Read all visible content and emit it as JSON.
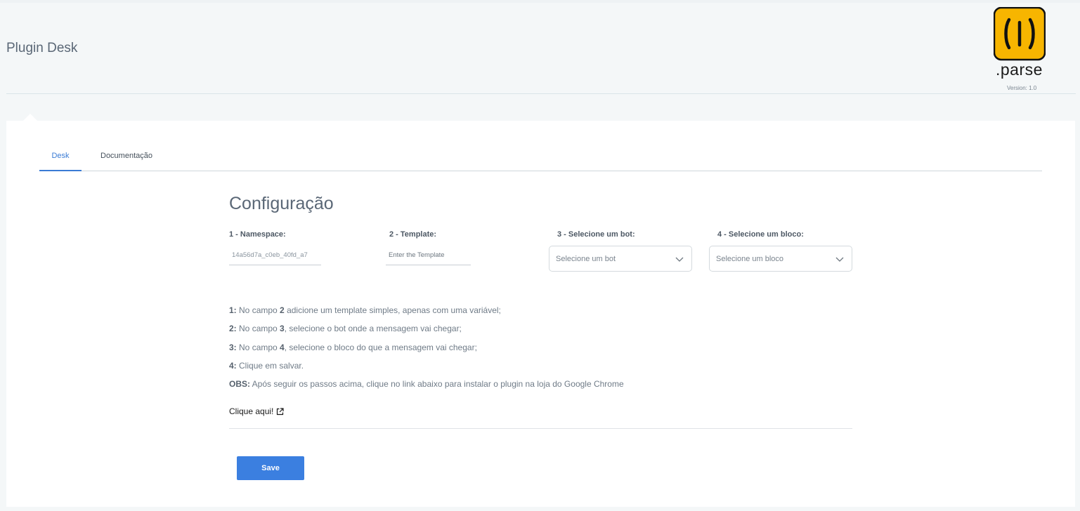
{
  "header": {
    "title": "Plugin Desk",
    "logo_text": ".parse",
    "version": "Version: 1.0"
  },
  "tabs": [
    {
      "label": "Desk",
      "active": true
    },
    {
      "label": "Documentação",
      "active": false
    }
  ],
  "config": {
    "title": "Configuração",
    "fields": {
      "namespace": {
        "label": "1 - Namespace:",
        "value": "14a56d7a_c0eb_40fd_a7"
      },
      "template": {
        "label": "2 - Template:",
        "placeholder": "Enter the Template",
        "value": ""
      },
      "bot": {
        "label": "3 - Selecione um bot:",
        "selected": "Selecione um bot"
      },
      "block": {
        "label": "4 - Selecione um bloco:",
        "selected": "Selecione um bloco"
      }
    },
    "steps": [
      {
        "prefix": "1:",
        "parts": [
          "No campo ",
          "2",
          " adicione um template simples, apenas com uma variável;"
        ]
      },
      {
        "prefix": "2:",
        "parts": [
          "No campo ",
          "3",
          ", selecione o bot onde a mensagem vai chegar;"
        ]
      },
      {
        "prefix": "3:",
        "parts": [
          "No campo ",
          "4",
          ", selecione o bloco do que a mensagem vai chegar;"
        ]
      },
      {
        "prefix": "4:",
        "parts": [
          "Clique em salvar.",
          "",
          ""
        ]
      },
      {
        "prefix": "OBS:",
        "parts": [
          "Após seguir os passos acima, clique no link abaixo para instalar o plugin na loja do Google Chrome",
          "",
          ""
        ]
      }
    ],
    "link_label": "Clique aqui!",
    "save_label": "Save"
  },
  "colors": {
    "accent": "#3a7bd5",
    "button": "#3b7fe0",
    "logo_yellow": "#f7b500",
    "background": "#f4f7f8"
  },
  "icons": [
    "parse-logo-icon",
    "chevron-down-icon",
    "external-link-icon"
  ]
}
